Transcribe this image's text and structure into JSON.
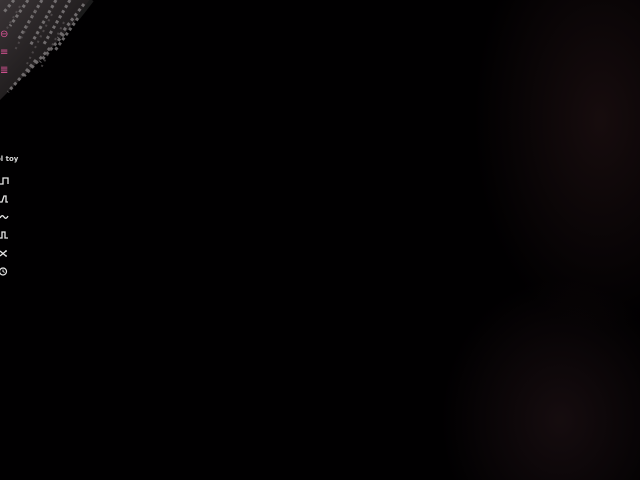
{
  "panel": {
    "title": "ol toy"
  },
  "overlay_icons": [
    {
      "name": "control-icon",
      "glyph": "⊖"
    },
    {
      "name": "menu-icon",
      "glyph": "≡"
    },
    {
      "name": "list-icon",
      "glyph": "≣"
    }
  ],
  "patterns": [
    {
      "name": "pattern-step-icon"
    },
    {
      "name": "pattern-pulse-icon"
    },
    {
      "name": "pattern-wave-icon"
    },
    {
      "name": "pattern-square-icon"
    },
    {
      "name": "pattern-random-icon"
    },
    {
      "name": "pattern-timer-icon"
    }
  ],
  "colors": {
    "accent": "#e0559a",
    "panel_text": "#d8d8d8",
    "background": "#010001"
  }
}
